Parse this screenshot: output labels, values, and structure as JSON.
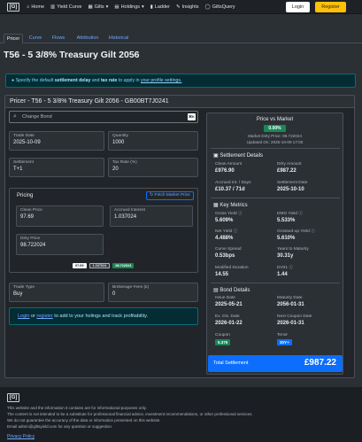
{
  "nav": {
    "logo": "[G]",
    "links": [
      {
        "label": "Home",
        "icon": "home-icon",
        "glyph": "⌂"
      },
      {
        "label": "Yield Curve",
        "icon": "chart-icon",
        "glyph": "▥"
      },
      {
        "label": "Gilts",
        "icon": "gilts-icon",
        "glyph": "▦",
        "dropdown": "▾"
      },
      {
        "label": "Holdings",
        "icon": "holdings-icon",
        "glyph": "▤",
        "dropdown": "▾"
      },
      {
        "label": "Ladder",
        "icon": "ladder-icon",
        "glyph": "▮"
      },
      {
        "label": "Insights",
        "icon": "insights-icon",
        "glyph": "✎"
      },
      {
        "label": "GiltsQuery",
        "icon": "query-icon",
        "glyph": "◯"
      }
    ],
    "login": "Login",
    "register": "Register"
  },
  "tabs": [
    "Pricer",
    "Curve",
    "Flows",
    "Attribution",
    "Historical"
  ],
  "page_title": "T56 - 5 3/8% Treasury Gilt 2056",
  "alert": {
    "pre": "Specify the default",
    "b1": "settlement delay",
    "mid": "and",
    "b2": "tax rate",
    "post": "to apply in",
    "link": "your profile settings."
  },
  "card_title": "Pricer - T56 - 5 3/8% Treasury Gilt 2056 - GB00BT7J0241",
  "search": {
    "placeholder": "Change Bond",
    "kbd": "⌘K"
  },
  "fields": {
    "trade_date": {
      "label": "Trade Date",
      "value": "2025-10-09"
    },
    "quantity": {
      "label": "Quantity",
      "value": "1000"
    },
    "settlement": {
      "label": "Settlement",
      "value": "T+1"
    },
    "tax_rate": {
      "label": "Tax Rate (%)",
      "value": "20"
    },
    "trade_type": {
      "label": "Trade Type",
      "value": "Buy"
    },
    "brokerage": {
      "label": "Brokerage Fees (£)",
      "value": "0"
    }
  },
  "pricing": {
    "title": "Pricing",
    "fetch": "Fetch Market Price",
    "clean_price": {
      "label": "Clean Price",
      "value": "97.69"
    },
    "accrued": {
      "label": "Accrued Interest",
      "value": "1.037024"
    },
    "dirty_price": {
      "label": "Dirty Price",
      "value": "98.722024"
    },
    "badges": [
      "97.69",
      "1.037024",
      "98.722024"
    ]
  },
  "info": {
    "link1": "Login",
    "mid": "or",
    "link2": "register",
    "post": "to add to your holings and track profitability."
  },
  "pvm": {
    "title": "Price vs Market",
    "badge": "0.00%",
    "market": "Market Dirty Price: 98.722024",
    "updated": "Updated On: 2025-10-09 17:00"
  },
  "settlement_details": {
    "title": "Settlement Details",
    "items": [
      {
        "label": "Clean Amount",
        "value": "£976.90"
      },
      {
        "label": "Dirty Amount",
        "value": "£987.22"
      },
      {
        "label": "Accrued Int. / Days",
        "value": "£10.37 / 71d"
      },
      {
        "label": "Settlement Date",
        "value": "2025-10-10"
      }
    ]
  },
  "key_metrics": {
    "title": "Key Metrics",
    "items": [
      {
        "label": "Gross Yield ⓘ",
        "value": "5.609%"
      },
      {
        "label": "DMO Yield ⓘ",
        "value": "5.533%"
      },
      {
        "label": "Net Yield ⓘ",
        "value": "4.488%"
      },
      {
        "label": "Grossed-up Yield ⓘ",
        "value": "5.610%"
      },
      {
        "label": "Curve Spread",
        "value": "0.53bps"
      },
      {
        "label": "Years to Maturity",
        "value": "30.31y"
      },
      {
        "label": "Modified Duration",
        "value": "14.55"
      },
      {
        "label": "DV01 ⓘ",
        "value": "1.44"
      }
    ]
  },
  "bond_details": {
    "title": "Bond Details",
    "items": [
      {
        "label": "Issue Date",
        "value": "2025-05-21"
      },
      {
        "label": "Maturity Date",
        "value": "2056-01-31"
      },
      {
        "label": "Ex. Div. Date",
        "value": "2026-01-22"
      },
      {
        "label": "Next Coupon Date",
        "value": "2026-01-31"
      }
    ],
    "coupon": {
      "label": "Coupon",
      "value": "5.375"
    },
    "tenor": {
      "label": "Tenor",
      "value": "30Y+"
    }
  },
  "total": {
    "label": "Total Settlement",
    "value": "£987.22"
  },
  "footer": {
    "logo": "[G]",
    "lines": [
      "This website and the information it contains are for informational purposes only.",
      "The content is not intended to be a substitute for professional financial advice, investment recommendations, or other professional services.",
      "We do not guarantee the accuracy of the data or information presented on this website.",
      "Email admin@giltsyield.com for any question or suggestion."
    ],
    "privacy": "Privacy Policy"
  },
  "colors": {
    "accent": "#0d6efd",
    "success": "#198754",
    "warning": "#ffc107",
    "info_bg": "#052c33"
  }
}
